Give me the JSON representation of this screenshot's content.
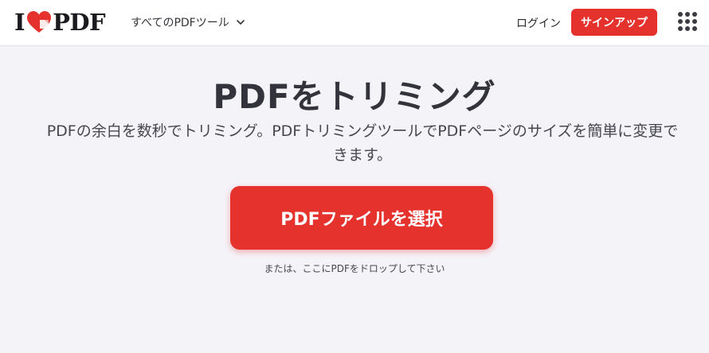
{
  "header": {
    "logo_left": "I",
    "logo_right": "PDF",
    "tools_menu_label": "すべてのPDFツール",
    "login_label": "ログイン",
    "signup_label": "サインアップ"
  },
  "main": {
    "title": "PDFをトリミング",
    "subtitle": "PDFの余白を数秒でトリミング。PDFトリミングツールでPDFページのサイズを簡単に変更できます。",
    "select_button_label": "PDFファイルを選択",
    "drop_hint": "または、ここにPDFをドロップして下さい"
  },
  "colors": {
    "brand_red": "#e5322d",
    "background": "#f4f3f8",
    "text": "#33333b"
  },
  "icons": {
    "logo_heart": "heart-icon",
    "tools_chevron": "chevron-down-icon",
    "apps_grid": "grid-dots-icon"
  }
}
